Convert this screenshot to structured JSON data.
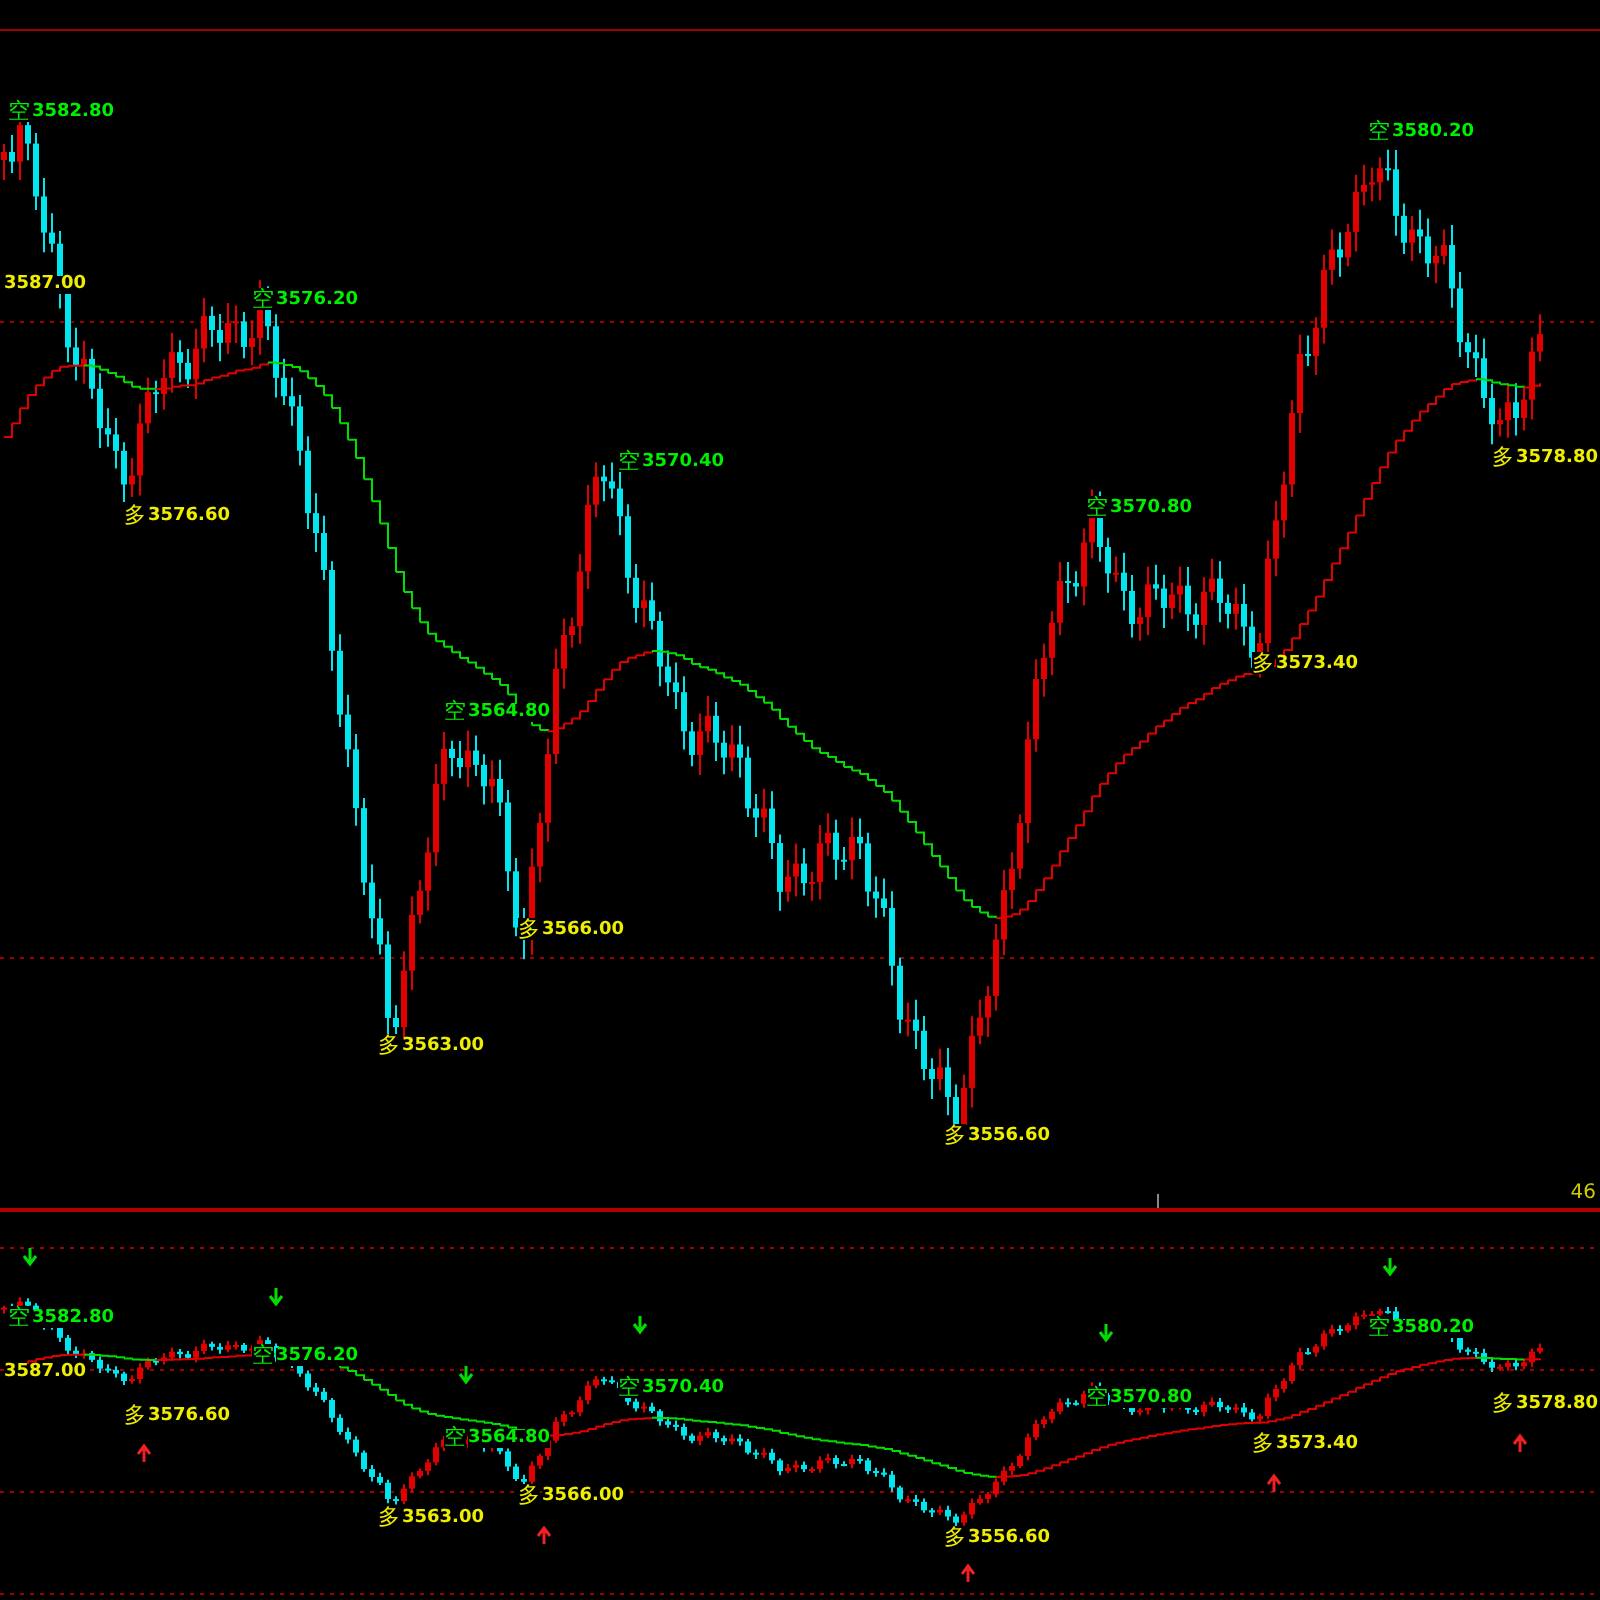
{
  "main_panel": {
    "price_label": "3587.00",
    "corner_text": "46",
    "markers": [
      {
        "kind": "short",
        "glyph": "空",
        "price": "3582.80"
      },
      {
        "kind": "short",
        "glyph": "空",
        "price": "3576.20"
      },
      {
        "kind": "long",
        "glyph": "多",
        "price": "3576.60"
      },
      {
        "kind": "short",
        "glyph": "空",
        "price": "3570.40"
      },
      {
        "kind": "short",
        "glyph": "空",
        "price": "3564.80"
      },
      {
        "kind": "long",
        "glyph": "多",
        "price": "3566.00"
      },
      {
        "kind": "long",
        "glyph": "多",
        "price": "3563.00"
      },
      {
        "kind": "long",
        "glyph": "多",
        "price": "3556.60"
      },
      {
        "kind": "short",
        "glyph": "空",
        "price": "3570.80"
      },
      {
        "kind": "long",
        "glyph": "多",
        "price": "3573.40"
      },
      {
        "kind": "short",
        "glyph": "空",
        "price": "3580.20"
      },
      {
        "kind": "long",
        "glyph": "多",
        "price": "3578.80"
      }
    ]
  },
  "sub_panel": {
    "price_label": "3587.00",
    "markers": [
      {
        "kind": "short",
        "glyph": "空",
        "price": "3582.80"
      },
      {
        "kind": "short",
        "glyph": "空",
        "price": "3576.20"
      },
      {
        "kind": "long",
        "glyph": "多",
        "price": "3576.60"
      },
      {
        "kind": "short",
        "glyph": "空",
        "price": "3570.40"
      },
      {
        "kind": "short",
        "glyph": "空",
        "price": "3564.80"
      },
      {
        "kind": "long",
        "glyph": "多",
        "price": "3566.00"
      },
      {
        "kind": "long",
        "glyph": "多",
        "price": "3563.00"
      },
      {
        "kind": "long",
        "glyph": "多",
        "price": "3556.60"
      },
      {
        "kind": "short",
        "glyph": "空",
        "price": "3570.80"
      },
      {
        "kind": "long",
        "glyph": "多",
        "price": "3573.40"
      },
      {
        "kind": "short",
        "glyph": "空",
        "price": "3580.20"
      },
      {
        "kind": "long",
        "glyph": "多",
        "price": "3578.80"
      }
    ]
  }
}
